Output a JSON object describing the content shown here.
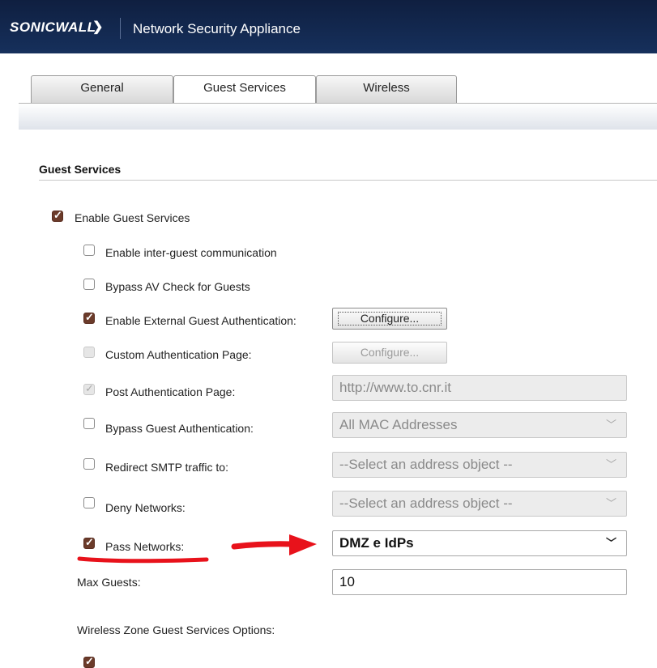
{
  "header": {
    "logo_text": "SONICWALL",
    "title": "Network Security Appliance"
  },
  "tabs": [
    {
      "label": "General",
      "active": false
    },
    {
      "label": "Guest Services",
      "active": true
    },
    {
      "label": "Wireless",
      "active": false
    }
  ],
  "section": {
    "title": "Guest Services"
  },
  "options": {
    "enable_guest_services": {
      "label": "Enable Guest Services",
      "checked": true
    },
    "inter_guest": {
      "label": "Enable inter-guest communication",
      "checked": false
    },
    "bypass_av": {
      "label": "Bypass AV Check for Guests",
      "checked": false
    },
    "external_auth": {
      "label": "Enable External Guest Authentication:",
      "checked": true,
      "button": "Configure..."
    },
    "custom_auth_page": {
      "label": "Custom Authentication Page:",
      "checked": false,
      "disabled": true,
      "button": "Configure..."
    },
    "post_auth_page": {
      "label": "Post Authentication Page:",
      "checked": true,
      "disabled": true,
      "value": "http://www.to.cnr.it"
    },
    "bypass_guest_auth": {
      "label": "Bypass Guest Authentication:",
      "checked": false,
      "selected": "All MAC Addresses"
    },
    "redirect_smtp": {
      "label": "Redirect SMTP traffic to:",
      "checked": false,
      "selected": "--Select an address object --"
    },
    "deny_networks": {
      "label": "Deny Networks:",
      "checked": false,
      "selected": "--Select an address object --"
    },
    "pass_networks": {
      "label": "Pass Networks:",
      "checked": true,
      "selected": "DMZ e IdPs"
    },
    "max_guests": {
      "label": "Max Guests:",
      "value": "10"
    }
  },
  "wireless_options": {
    "title": "Wireless Zone Guest Services Options:"
  },
  "colors": {
    "header_bg": "#13284d",
    "checkbox_checked": "#6b3b2a",
    "annotation_red": "#e8121b"
  },
  "icons": {
    "dropdown": "chevron-down-icon",
    "check": "checkmark-icon"
  }
}
